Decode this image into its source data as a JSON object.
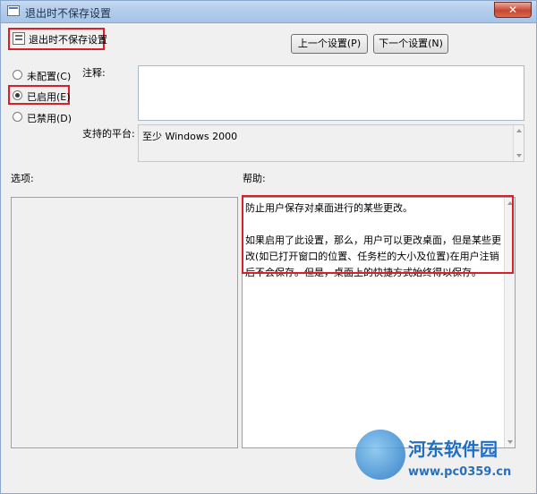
{
  "window": {
    "title": "退出时不保存设置",
    "close_glyph": "✕"
  },
  "setting": {
    "name": "退出时不保存设置"
  },
  "nav": {
    "prev_label": "上一个设置(P)",
    "next_label": "下一个设置(N)"
  },
  "state_options": [
    {
      "label": "未配置(C)",
      "checked": false
    },
    {
      "label": "已启用(E)",
      "checked": true
    },
    {
      "label": "已禁用(D)",
      "checked": false
    }
  ],
  "comment": {
    "label": "注释:",
    "value": ""
  },
  "platform": {
    "label": "支持的平台:",
    "value": "至少 Windows 2000"
  },
  "options": {
    "label": "选项:"
  },
  "help": {
    "label": "帮助:",
    "paragraph1": "防止用户保存对桌面进行的某些更改。",
    "paragraph2": "如果启用了此设置，那么，用户可以更改桌面，但是某些更改(如已打开窗口的位置、任务栏的大小及位置)在用户注销后不会保存。但是，桌面上的快捷方式始终得以保存。"
  },
  "watermark": {
    "name": "河东软件园",
    "url": "www.pc0359.cn"
  },
  "colors": {
    "highlight": "#d8202a",
    "titlebar": "#b3cdec"
  }
}
